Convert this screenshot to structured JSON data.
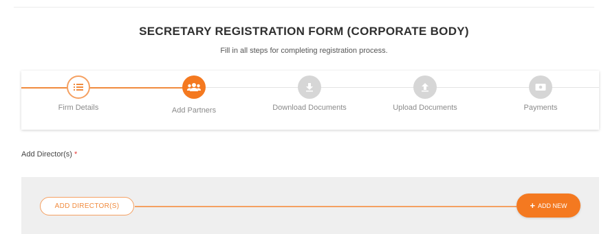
{
  "form": {
    "title": "SECRETARY REGISTRATION FORM (CORPORATE BODY)",
    "subtitle": "Fill in all steps for completing registration process."
  },
  "steps": [
    {
      "label": "Firm Details",
      "state": "done",
      "icon": "list-icon"
    },
    {
      "label": "Add Partners",
      "state": "active",
      "icon": "users-icon"
    },
    {
      "label": "Download Documents",
      "state": "pending",
      "icon": "download-icon"
    },
    {
      "label": "Upload Documents",
      "state": "pending",
      "icon": "upload-icon"
    },
    {
      "label": "Payments",
      "state": "pending",
      "icon": "payment-icon"
    }
  ],
  "directors": {
    "label": "Add Director(s)",
    "required_mark": "*",
    "add_directors_button": "ADD DIRECTOR(S)",
    "add_new_button": "ADD NEW",
    "add_new_icon": "+"
  },
  "colors": {
    "accent": "#f47920",
    "accent_light": "#f5a061",
    "pending": "#d6d6d6",
    "required": "#e53935"
  }
}
